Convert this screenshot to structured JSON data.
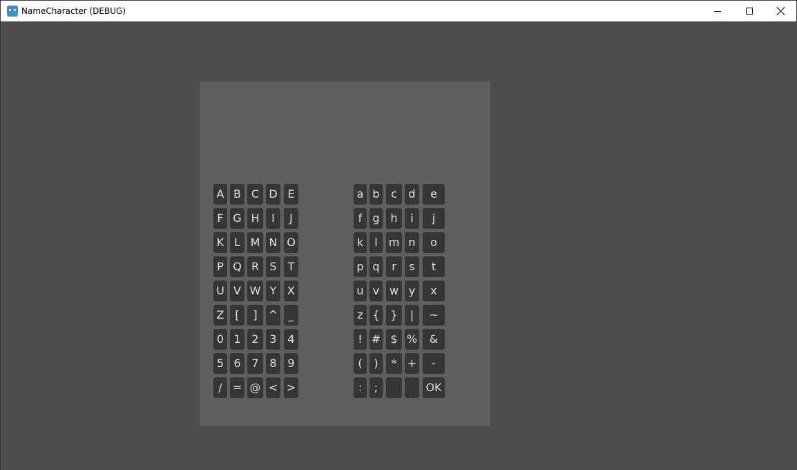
{
  "window": {
    "title": "NameCharacter (DEBUG)"
  },
  "keyboard": {
    "left_rows": [
      [
        "A",
        "B",
        "C",
        "D",
        "E"
      ],
      [
        "F",
        "G",
        "H",
        "I",
        "J"
      ],
      [
        "K",
        "L",
        "M",
        "N",
        "O"
      ],
      [
        "P",
        "Q",
        "R",
        "S",
        "T"
      ],
      [
        "U",
        "V",
        "W",
        "Y",
        "X"
      ],
      [
        "Z",
        "[",
        "]",
        "^",
        "_"
      ],
      [
        "0",
        "1",
        "2",
        "3",
        "4"
      ],
      [
        "5",
        "6",
        "7",
        "8",
        "9"
      ],
      [
        "/",
        "=",
        "@",
        "<",
        ">"
      ]
    ],
    "right_rows": [
      [
        "a",
        "b",
        "c",
        "d",
        "e"
      ],
      [
        "f",
        "g",
        "h",
        "i",
        "j"
      ],
      [
        "k",
        "l",
        "m",
        "n",
        "o"
      ],
      [
        "p",
        "q",
        "r",
        "s",
        "t"
      ],
      [
        "u",
        "v",
        "w",
        "y",
        "x"
      ],
      [
        "z",
        "{",
        "}",
        "|",
        "~"
      ],
      [
        "!",
        "#",
        "$",
        "%",
        "&"
      ],
      [
        "(",
        ")",
        "*",
        "+",
        "-"
      ],
      [
        ":",
        ";",
        "",
        "",
        "OK"
      ]
    ]
  }
}
